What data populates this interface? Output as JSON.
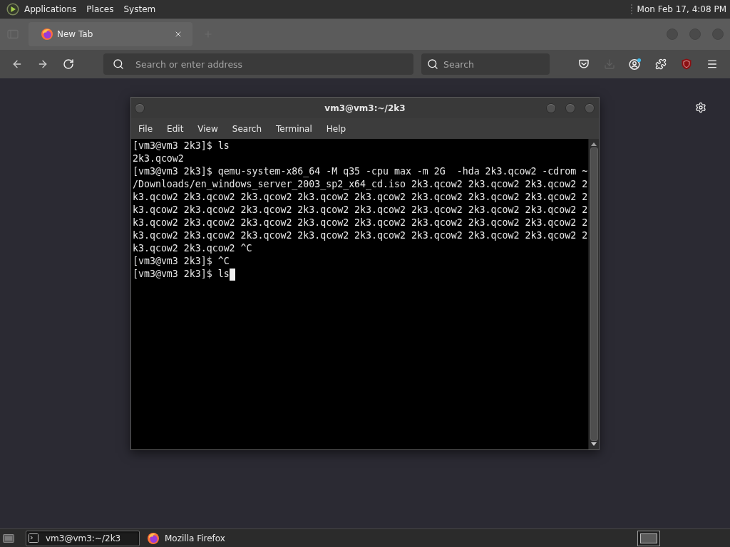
{
  "top_panel": {
    "menus": [
      "Applications",
      "Places",
      "System"
    ],
    "clock": "Mon Feb 17, 4:08 PM"
  },
  "browser": {
    "tabs": [
      {
        "title": "New Tab",
        "selected": true
      }
    ],
    "address_field": {
      "placeholder": "Search or enter address"
    },
    "search_field": {
      "placeholder": "Search"
    }
  },
  "terminal_window": {
    "title": "vm3@vm3:~/2k3",
    "menu": [
      "File",
      "Edit",
      "View",
      "Search",
      "Terminal",
      "Help"
    ],
    "lines": [
      "[vm3@vm3 2k3]$ ls",
      "2k3.qcow2",
      "[vm3@vm3 2k3]$ qemu-system-x86_64 -M q35 -cpu max -m 2G  -hda 2k3.qcow2 -cdrom ~",
      "/Downloads/en_windows_server_2003_sp2_x64_cd.iso 2k3.qcow2 2k3.qcow2 2k3.qcow2 2",
      "k3.qcow2 2k3.qcow2 2k3.qcow2 2k3.qcow2 2k3.qcow2 2k3.qcow2 2k3.qcow2 2k3.qcow2 2",
      "k3.qcow2 2k3.qcow2 2k3.qcow2 2k3.qcow2 2k3.qcow2 2k3.qcow2 2k3.qcow2 2k3.qcow2 2",
      "k3.qcow2 2k3.qcow2 2k3.qcow2 2k3.qcow2 2k3.qcow2 2k3.qcow2 2k3.qcow2 2k3.qcow2 2",
      "k3.qcow2 2k3.qcow2 2k3.qcow2 2k3.qcow2 2k3.qcow2 2k3.qcow2 2k3.qcow2 2k3.qcow2 2",
      "k3.qcow2 2k3.qcow2 ^C",
      "[vm3@vm3 2k3]$ ^C",
      "[vm3@vm3 2k3]$ ls"
    ],
    "cursor_visible": true
  },
  "taskbar": {
    "items": [
      {
        "kind": "terminal",
        "label": "vm3@vm3:~/2k3",
        "selected": true
      },
      {
        "kind": "browser",
        "label": "Mozilla Firefox",
        "selected": false
      }
    ]
  }
}
